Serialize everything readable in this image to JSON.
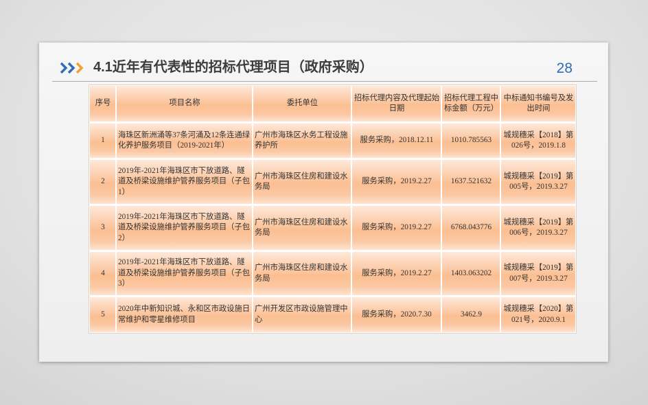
{
  "slide": {
    "title": "4.1近年有代表性的招标代理项目（政府采购）",
    "page_number": "28"
  },
  "icons": {
    "title_marker": "triple-chevron-right-icon"
  },
  "colors": {
    "accent_blue": "#2e6db4",
    "accent_orange": "#f0a030",
    "title_text": "#3c3c3c",
    "table_text": "#333333",
    "row_light": "#fee8d9",
    "row_orange": "#fbbf92"
  },
  "table": {
    "headers": [
      "序号",
      "项目名称",
      "委托单位",
      "招标代理内容及代理起始日期",
      "招标代理工程中标金额（万元）",
      "中标通知书编号及发出时间"
    ],
    "rows": [
      {
        "no": "1",
        "name": "海珠区新洲涌等37条河涌及12条连通绿化养护服务项目（2019-2021年）",
        "client": "广州市海珠区水务工程设施养护所",
        "content": "服务采购，2018.12.11",
        "amount": "1010.785563",
        "notice": "城规穗采【2018】第026号，2019.1.8"
      },
      {
        "no": "2",
        "name": "2019年-2021年海珠区市下放道路、隧道及桥梁设施维护管养服务项目（子包1）",
        "client": "广州市海珠区住房和建设水务局",
        "content": "服务采购，2019.2.27",
        "amount": "1637.521632",
        "notice": "城规穗采【2019】第005号，2019.3.27"
      },
      {
        "no": "3",
        "name": "2019年-2021年海珠区市下放道路、隧道及桥梁设施维护管养服务项目（子包2）",
        "client": "广州市海珠区住房和建设水务局",
        "content": "服务采购，2019.2.27",
        "amount": "6768.043776",
        "notice": "城规穗采【2019】第006号，2019.3.27"
      },
      {
        "no": "4",
        "name": "2019年-2021年海珠区市下放道路、隧道及桥梁设施维护管养服务项目（子包3）",
        "client": "广州市海珠区住房和建设水务局",
        "content": "服务采购，2019.2.27",
        "amount": "1403.063202",
        "notice": "城规穗采【2019】第007号，2019.3.27"
      },
      {
        "no": "5",
        "name": "2020年中新知识城、永和区市政设施日常维护和零星维修项目",
        "client": "广州开发区市政设施管理中心",
        "content": "服务采购，2020.7.30",
        "amount": "3462.9",
        "notice": "城规穗采【2020】第021号，2020.9.1"
      }
    ]
  }
}
